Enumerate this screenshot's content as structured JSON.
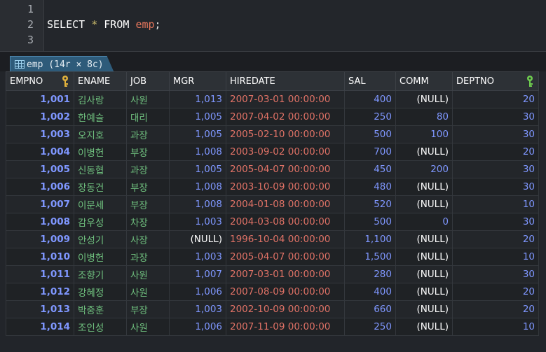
{
  "editor": {
    "line_numbers": [
      "1",
      "2",
      "3"
    ],
    "sql": {
      "kw1": "SELECT",
      "star": "*",
      "kw2": "FROM",
      "table": "emp",
      "end": ";"
    }
  },
  "result_tab": {
    "label": "emp (14r × 8c)",
    "icon": "table-grid-icon"
  },
  "grid": {
    "columns": [
      "EMPNO",
      "ENAME",
      "JOB",
      "MGR",
      "HIREDATE",
      "SAL",
      "COMM",
      "DEPTNO"
    ],
    "key_icons": {
      "EMPNO": "primary-key-icon",
      "DEPTNO": "foreign-key-icon"
    },
    "rows": [
      [
        "1,001",
        "김사랑",
        "사원",
        "1,013",
        "2007-03-01 00:00:00",
        "400",
        "(NULL)",
        "20"
      ],
      [
        "1,002",
        "한예슬",
        "대리",
        "1,005",
        "2007-04-02 00:00:00",
        "250",
        "80",
        "30"
      ],
      [
        "1,003",
        "오지호",
        "과장",
        "1,005",
        "2005-02-10 00:00:00",
        "500",
        "100",
        "30"
      ],
      [
        "1,004",
        "이병헌",
        "부장",
        "1,008",
        "2003-09-02 00:00:00",
        "700",
        "(NULL)",
        "20"
      ],
      [
        "1,005",
        "신동협",
        "과장",
        "1,005",
        "2005-04-07 00:00:00",
        "450",
        "200",
        "30"
      ],
      [
        "1,006",
        "장동건",
        "부장",
        "1,008",
        "2003-10-09 00:00:00",
        "480",
        "(NULL)",
        "30"
      ],
      [
        "1,007",
        "이문세",
        "부장",
        "1,008",
        "2004-01-08 00:00:00",
        "520",
        "(NULL)",
        "10"
      ],
      [
        "1,008",
        "감우성",
        "차장",
        "1,003",
        "2004-03-08 00:00:00",
        "500",
        "0",
        "30"
      ],
      [
        "1,009",
        "안성기",
        "사장",
        "(NULL)",
        "1996-10-04 00:00:00",
        "1,100",
        "(NULL)",
        "20"
      ],
      [
        "1,010",
        "이병헌",
        "과장",
        "1,003",
        "2005-04-07 00:00:00",
        "1,500",
        "(NULL)",
        "10"
      ],
      [
        "1,011",
        "조향기",
        "사원",
        "1,007",
        "2007-03-01 00:00:00",
        "280",
        "(NULL)",
        "30"
      ],
      [
        "1,012",
        "강혜정",
        "사원",
        "1,006",
        "2007-08-09 00:00:00",
        "400",
        "(NULL)",
        "20"
      ],
      [
        "1,013",
        "박중훈",
        "부장",
        "1,003",
        "2002-10-09 00:00:00",
        "660",
        "(NULL)",
        "20"
      ],
      [
        "1,014",
        "조인성",
        "사원",
        "1,006",
        "2007-11-09 00:00:00",
        "250",
        "(NULL)",
        "10"
      ]
    ]
  },
  "colors": {
    "number": "#7f97ff",
    "text": "#6fc07e",
    "date": "#e07266",
    "null": "#ffffff",
    "key_pk": "#e3b23c",
    "key_fk": "#6fcf4f"
  }
}
